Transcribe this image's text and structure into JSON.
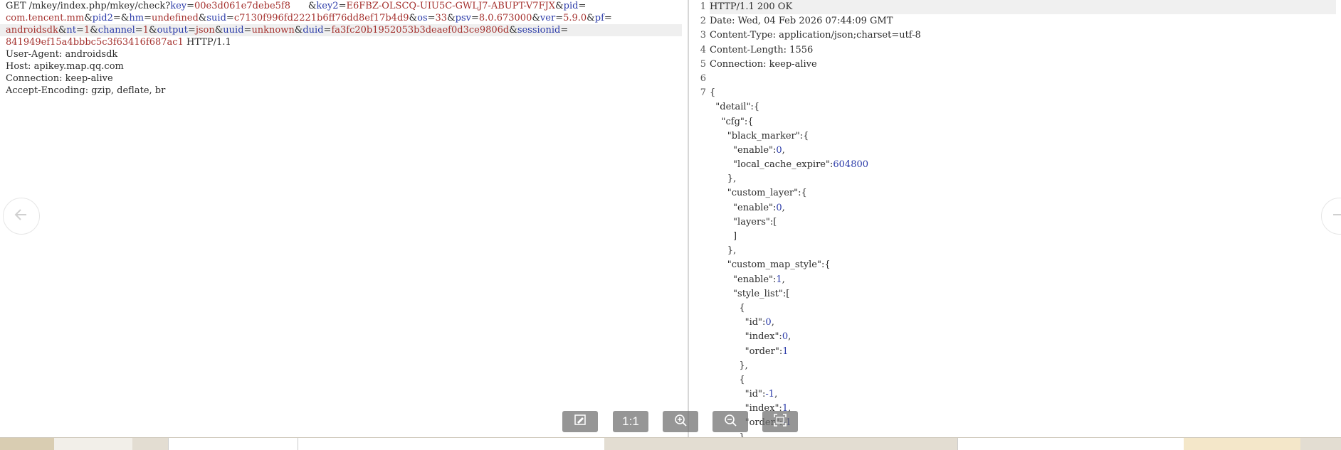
{
  "request": {
    "lines": [
      [
        {
          "t": "GET /mkey/index.php/mkey/check?",
          "c": "p"
        },
        {
          "t": "key",
          "c": "k"
        },
        {
          "t": "=",
          "c": "p"
        },
        {
          "t": "00e3d061e7debe5f8",
          "c": "v"
        },
        {
          "t": "      ",
          "c": "p"
        },
        {
          "t": "&",
          "c": "p"
        },
        {
          "t": "key2",
          "c": "k"
        },
        {
          "t": "=",
          "c": "p"
        },
        {
          "t": "E6FBZ-OLSCQ-UIU5C-GWLJ7-ABUPT-V7FJX",
          "c": "v"
        },
        {
          "t": "&",
          "c": "p"
        },
        {
          "t": "pid",
          "c": "k"
        },
        {
          "t": "=",
          "c": "p"
        }
      ],
      [
        {
          "t": "com.tencent.mm",
          "c": "v"
        },
        {
          "t": "&",
          "c": "p"
        },
        {
          "t": "pid2",
          "c": "k"
        },
        {
          "t": "=",
          "c": "p"
        },
        {
          "t": "&",
          "c": "p"
        },
        {
          "t": "hm",
          "c": "k"
        },
        {
          "t": "=",
          "c": "p"
        },
        {
          "t": "undefined",
          "c": "v"
        },
        {
          "t": "&",
          "c": "p"
        },
        {
          "t": "suid",
          "c": "k"
        },
        {
          "t": "=",
          "c": "p"
        },
        {
          "t": "c7130f996fd2221b6ff76dd8ef17b4d9",
          "c": "v"
        },
        {
          "t": "&",
          "c": "p"
        },
        {
          "t": "os",
          "c": "k"
        },
        {
          "t": "=",
          "c": "p"
        },
        {
          "t": "33",
          "c": "v"
        },
        {
          "t": "&",
          "c": "p"
        },
        {
          "t": "psv",
          "c": "k"
        },
        {
          "t": "=",
          "c": "p"
        },
        {
          "t": "8.0.673000",
          "c": "v"
        },
        {
          "t": "&",
          "c": "p"
        },
        {
          "t": "ver",
          "c": "k"
        },
        {
          "t": "=",
          "c": "p"
        },
        {
          "t": "5.9.0",
          "c": "v"
        },
        {
          "t": "&",
          "c": "p"
        },
        {
          "t": "pf",
          "c": "k"
        },
        {
          "t": "=",
          "c": "p"
        }
      ],
      [
        {
          "t": "androidsdk",
          "c": "v"
        },
        {
          "t": "&",
          "c": "p"
        },
        {
          "t": "nt",
          "c": "k"
        },
        {
          "t": "=",
          "c": "p"
        },
        {
          "t": "1",
          "c": "v"
        },
        {
          "t": "&",
          "c": "p"
        },
        {
          "t": "channel",
          "c": "k"
        },
        {
          "t": "=",
          "c": "p"
        },
        {
          "t": "1",
          "c": "v"
        },
        {
          "t": "&",
          "c": "p"
        },
        {
          "t": "output",
          "c": "k"
        },
        {
          "t": "=",
          "c": "p"
        },
        {
          "t": "json",
          "c": "v"
        },
        {
          "t": "&",
          "c": "p"
        },
        {
          "t": "uuid",
          "c": "k"
        },
        {
          "t": "=",
          "c": "p"
        },
        {
          "t": "unknown",
          "c": "v"
        },
        {
          "t": "&",
          "c": "p"
        },
        {
          "t": "duid",
          "c": "k"
        },
        {
          "t": "=",
          "c": "p"
        },
        {
          "t": "fa3fc20b1952053b3deaef0d3ce9806d",
          "c": "v"
        },
        {
          "t": "&",
          "c": "p"
        },
        {
          "t": "sessionid",
          "c": "k"
        },
        {
          "t": "=",
          "c": "p"
        }
      ],
      [
        {
          "t": "841949ef15a4bbbc5c3f63416f687ac1",
          "c": "v"
        },
        {
          "t": " HTTP/1.1",
          "c": "p"
        }
      ],
      [
        {
          "t": "User-Agent: androidsdk",
          "c": "p"
        }
      ],
      [
        {
          "t": "Host: apikey.map.qq.com",
          "c": "p"
        }
      ],
      [
        {
          "t": "Connection: keep-alive",
          "c": "p"
        }
      ],
      [
        {
          "t": "Accept-Encoding: gzip, deflate, br",
          "c": "p"
        }
      ]
    ],
    "highlighted_line": 2
  },
  "response": {
    "line_numbers": [
      "1",
      "2",
      "3",
      "4",
      "5",
      "6",
      "7"
    ],
    "rows": [
      [
        {
          "t": "HTTP/1.1 200 OK",
          "c": "jk"
        }
      ],
      [
        {
          "t": "Date: Wed, 04 Feb 2026 07:44:09 GMT",
          "c": "jk"
        }
      ],
      [
        {
          "t": "Content-Type: application/json;charset=utf-8",
          "c": "jk"
        }
      ],
      [
        {
          "t": "Content-Length: 1556",
          "c": "jk"
        }
      ],
      [
        {
          "t": "Connection: keep-alive",
          "c": "jk"
        }
      ],
      [
        {
          "t": "",
          "c": "jk"
        }
      ],
      [
        {
          "t": "{",
          "c": "jk"
        }
      ],
      [
        {
          "t": "  \"detail\":{",
          "c": "jk"
        }
      ],
      [
        {
          "t": "    \"cfg\":{",
          "c": "jk"
        }
      ],
      [
        {
          "t": "      \"black_marker\":{",
          "c": "jk"
        }
      ],
      [
        {
          "t": "        \"enable\":",
          "c": "jk"
        },
        {
          "t": "0",
          "c": "jn"
        },
        {
          "t": ",",
          "c": "jk"
        }
      ],
      [
        {
          "t": "        \"local_cache_expire\":",
          "c": "jk"
        },
        {
          "t": "604800",
          "c": "jn"
        }
      ],
      [
        {
          "t": "      },",
          "c": "jk"
        }
      ],
      [
        {
          "t": "      \"custom_layer\":{",
          "c": "jk"
        }
      ],
      [
        {
          "t": "        \"enable\":",
          "c": "jk"
        },
        {
          "t": "0",
          "c": "jn"
        },
        {
          "t": ",",
          "c": "jk"
        }
      ],
      [
        {
          "t": "        \"layers\":[",
          "c": "jk"
        }
      ],
      [
        {
          "t": "        ]",
          "c": "jk"
        }
      ],
      [
        {
          "t": "      },",
          "c": "jk"
        }
      ],
      [
        {
          "t": "      \"custom_map_style\":{",
          "c": "jk"
        }
      ],
      [
        {
          "t": "        \"enable\":",
          "c": "jk"
        },
        {
          "t": "1",
          "c": "jn"
        },
        {
          "t": ",",
          "c": "jk"
        }
      ],
      [
        {
          "t": "        \"style_list\":[",
          "c": "jk"
        }
      ],
      [
        {
          "t": "          {",
          "c": "jk"
        }
      ],
      [
        {
          "t": "            \"id\":",
          "c": "jk"
        },
        {
          "t": "0",
          "c": "jn"
        },
        {
          "t": ",",
          "c": "jk"
        }
      ],
      [
        {
          "t": "            \"index\":",
          "c": "jk"
        },
        {
          "t": "0",
          "c": "jn"
        },
        {
          "t": ",",
          "c": "jk"
        }
      ],
      [
        {
          "t": "            \"order\":",
          "c": "jk"
        },
        {
          "t": "1",
          "c": "jn"
        }
      ],
      [
        {
          "t": "          },",
          "c": "jk"
        }
      ],
      [
        {
          "t": "          {",
          "c": "jk"
        }
      ],
      [
        {
          "t": "            \"id\":",
          "c": "jk"
        },
        {
          "t": "-1",
          "c": "jn"
        },
        {
          "t": ",",
          "c": "jk"
        }
      ],
      [
        {
          "t": "            \"index\":",
          "c": "jk"
        },
        {
          "t": "1",
          "c": "jn"
        },
        {
          "t": ",",
          "c": "jk"
        }
      ],
      [
        {
          "t": "            \"order\":",
          "c": "jk"
        },
        {
          "t": "-1",
          "c": "jn"
        }
      ],
      [
        {
          "t": "          }",
          "c": "jk"
        }
      ]
    ],
    "highlighted_row": 0
  },
  "toolbar": {
    "buttons": [
      {
        "name": "edit-image-button",
        "icon": "edit-icon",
        "label": ""
      },
      {
        "name": "actual-size-button",
        "icon": "",
        "label": "1:1"
      },
      {
        "name": "zoom-in-button",
        "icon": "zoom-in-icon",
        "label": ""
      },
      {
        "name": "zoom-out-button",
        "icon": "zoom-out-icon",
        "label": ""
      },
      {
        "name": "fit-screen-button",
        "icon": "fit-screen-icon",
        "label": ""
      }
    ]
  },
  "nav": {
    "prev_icon": "arrow-left-icon",
    "next_icon": "arrow-right-icon"
  },
  "colors": {
    "param_key": "#2a3aa8",
    "param_value": "#a4302d",
    "text": "#2b2b2b",
    "toolbar_bg": "#6e6e6e"
  }
}
